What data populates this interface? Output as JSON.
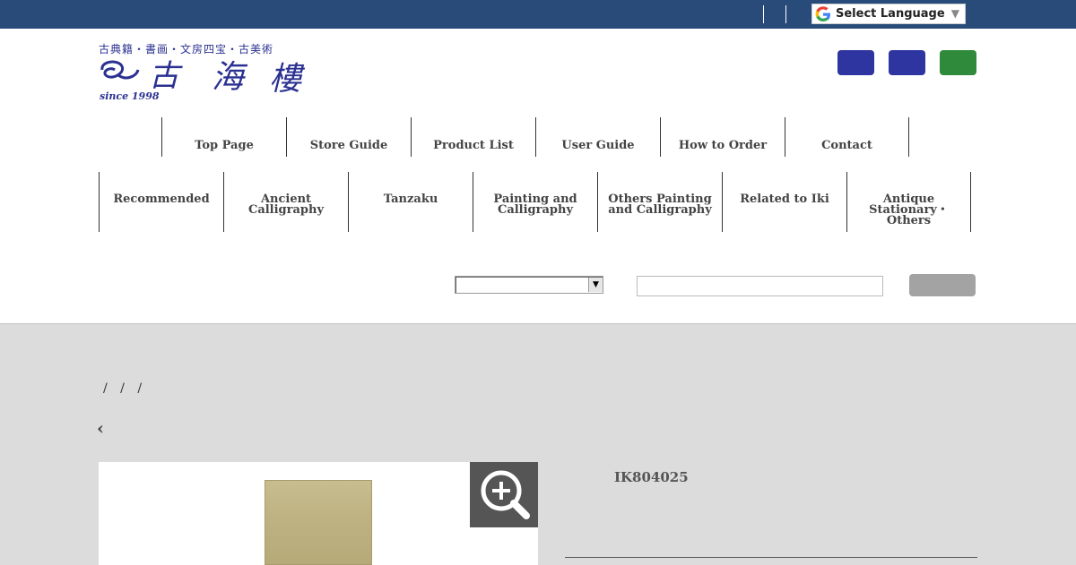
{
  "topbar": {
    "language_label": "Select Language",
    "language_arrow": "▼",
    "google_icon": "google-g-icon"
  },
  "logo": {
    "tagline": "古典籍・書画・文房四宝・古美術",
    "name": "古海樓",
    "since": "since 1998"
  },
  "header_buttons": [
    {
      "color": "#2e35a0"
    },
    {
      "color": "#2e35a0"
    },
    {
      "color": "#2f8a3b"
    }
  ],
  "nav_main": [
    "Top Page",
    "Store Guide",
    "Product List",
    "User Guide",
    "How to Order",
    "Contact"
  ],
  "nav_category": [
    "Recommended",
    "Ancient Calligraphy",
    "Tanzaku",
    "Painting and Calligraphy",
    "Others Painting and Calligraphy",
    "Related to Iki",
    "Antique Stationary・Others"
  ],
  "search": {
    "select_value": "",
    "input_value": "",
    "button_label": ""
  },
  "breadcrumb": "/ / /",
  "back_label": "‹",
  "product": {
    "code": "IK804025",
    "zoom_icon": "zoom-in-icon"
  }
}
